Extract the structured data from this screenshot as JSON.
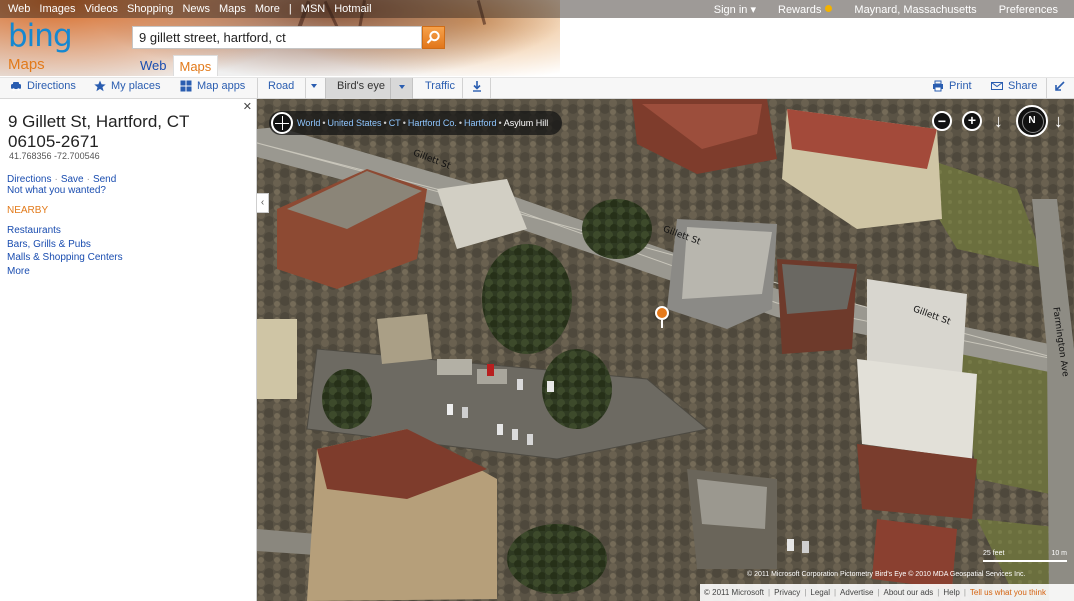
{
  "topnav": {
    "links": [
      "Web",
      "Images",
      "Videos",
      "Shopping",
      "News",
      "Maps",
      "More"
    ],
    "msn": "MSN",
    "hotmail": "Hotmail",
    "signin": "Sign in ▾",
    "rewards": "Rewards",
    "location": "Maynard, Massachusetts",
    "preferences": "Preferences"
  },
  "logo": {
    "brand": "bing",
    "product": "Maps"
  },
  "search": {
    "value": "9 gillett street, hartford, ct"
  },
  "vertical_tabs": {
    "web": "Web",
    "maps": "Maps"
  },
  "toolbar": {
    "directions": "Directions",
    "my_places": "My places",
    "map_apps": "Map apps",
    "road": "Road",
    "birds_eye": "Bird's eye",
    "traffic": "Traffic",
    "print": "Print",
    "share": "Share"
  },
  "result": {
    "address": "9 Gillett St, Hartford, CT 06105-2671",
    "coords": "41.768356 -72.700546",
    "action_directions": "Directions",
    "action_save": "Save",
    "action_send": "Send",
    "not_wanted": "Not what you wanted?",
    "nearby_title": "NEARBY",
    "nearby": {
      "restaurants": "Restaurants",
      "bars": "Bars, Grills & Pubs",
      "malls": "Malls & Shopping Centers",
      "more": "More"
    }
  },
  "map": {
    "breadcrumb": {
      "world": "World",
      "us": "United States",
      "ct": "CT",
      "county": "Hartford Co.",
      "city": "Hartford",
      "hood": "Asylum Hill"
    },
    "compass": "N",
    "streets": {
      "gillett1": "Gillett St",
      "gillett2": "Gillett St",
      "gillett3": "Gillett St",
      "farmington": "Farmington Ave"
    },
    "scale_feet": "25 feet",
    "scale_m": "10 m",
    "copyright": "© 2011 Microsoft Corporation   Pictometry Bird's Eye © 2010 MDA Geospatial Services Inc."
  },
  "footer": {
    "copyright": "© 2011 Microsoft",
    "privacy": "Privacy",
    "legal": "Legal",
    "advertise": "Advertise",
    "about_ads": "About our ads",
    "help": "Help",
    "tell_us": "Tell us what you think"
  },
  "colors": {
    "bing_blue": "#1588d1",
    "maps_orange": "#e27a1a",
    "link_blue": "#1a4db0"
  }
}
